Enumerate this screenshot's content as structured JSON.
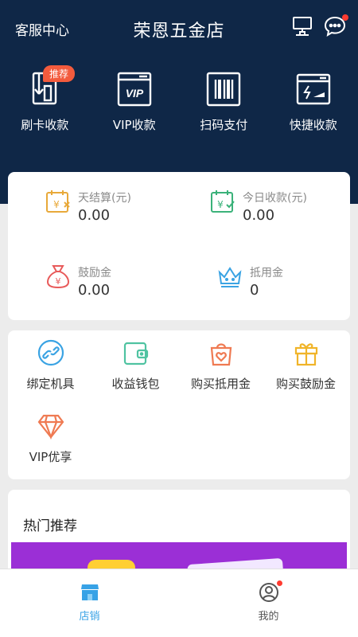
{
  "header": {
    "service_label": "客服中心",
    "title": "荣恩五金店",
    "icons": [
      "computer-terminal-icon",
      "message-icon"
    ]
  },
  "quick_actions": [
    {
      "label": "刷卡收款",
      "icon": "card-swipe-icon",
      "badge": "推荐"
    },
    {
      "label": "VIP收款",
      "icon": "vip-card-icon",
      "icon_text": "VIP"
    },
    {
      "label": "扫码支付",
      "icon": "barcode-scan-icon"
    },
    {
      "label": "快捷收款",
      "icon": "quick-pay-icon"
    }
  ],
  "stats": [
    {
      "label": "天结算(元)",
      "value": "0.00",
      "icon": "calendar-yuan-icon",
      "color": "#e8a93a"
    },
    {
      "label": "今日收款(元)",
      "value": "0.00",
      "icon": "calendar-check-icon",
      "color": "#3bb27a"
    },
    {
      "label": "鼓励金",
      "value": "0.00",
      "icon": "money-bag-icon",
      "color": "#e85a5a"
    },
    {
      "label": "抵用金",
      "value": "0",
      "icon": "crown-icon",
      "color": "#3aa3e3"
    }
  ],
  "tools": [
    {
      "label": "绑定机具",
      "icon": "link-icon",
      "color": "#3aa3e3"
    },
    {
      "label": "收益钱包",
      "icon": "wallet-icon",
      "color": "#4fc3a1"
    },
    {
      "label": "购买抵用金",
      "icon": "shopping-bag-heart-icon",
      "color": "#ef7a52"
    },
    {
      "label": "购买鼓励金",
      "icon": "gift-icon",
      "color": "#f0b429"
    },
    {
      "label": "VIP优享",
      "icon": "diamond-icon",
      "color": "#ef7a52"
    }
  ],
  "hot": {
    "title": "热门推荐"
  },
  "tabbar": [
    {
      "label": "店销",
      "icon": "store-icon",
      "active": true
    },
    {
      "label": "我的",
      "icon": "user-icon",
      "active": false
    }
  ],
  "colors": {
    "header_bg": "#0f2747",
    "accent": "#37a2e6",
    "badge": "#f35b3d"
  }
}
